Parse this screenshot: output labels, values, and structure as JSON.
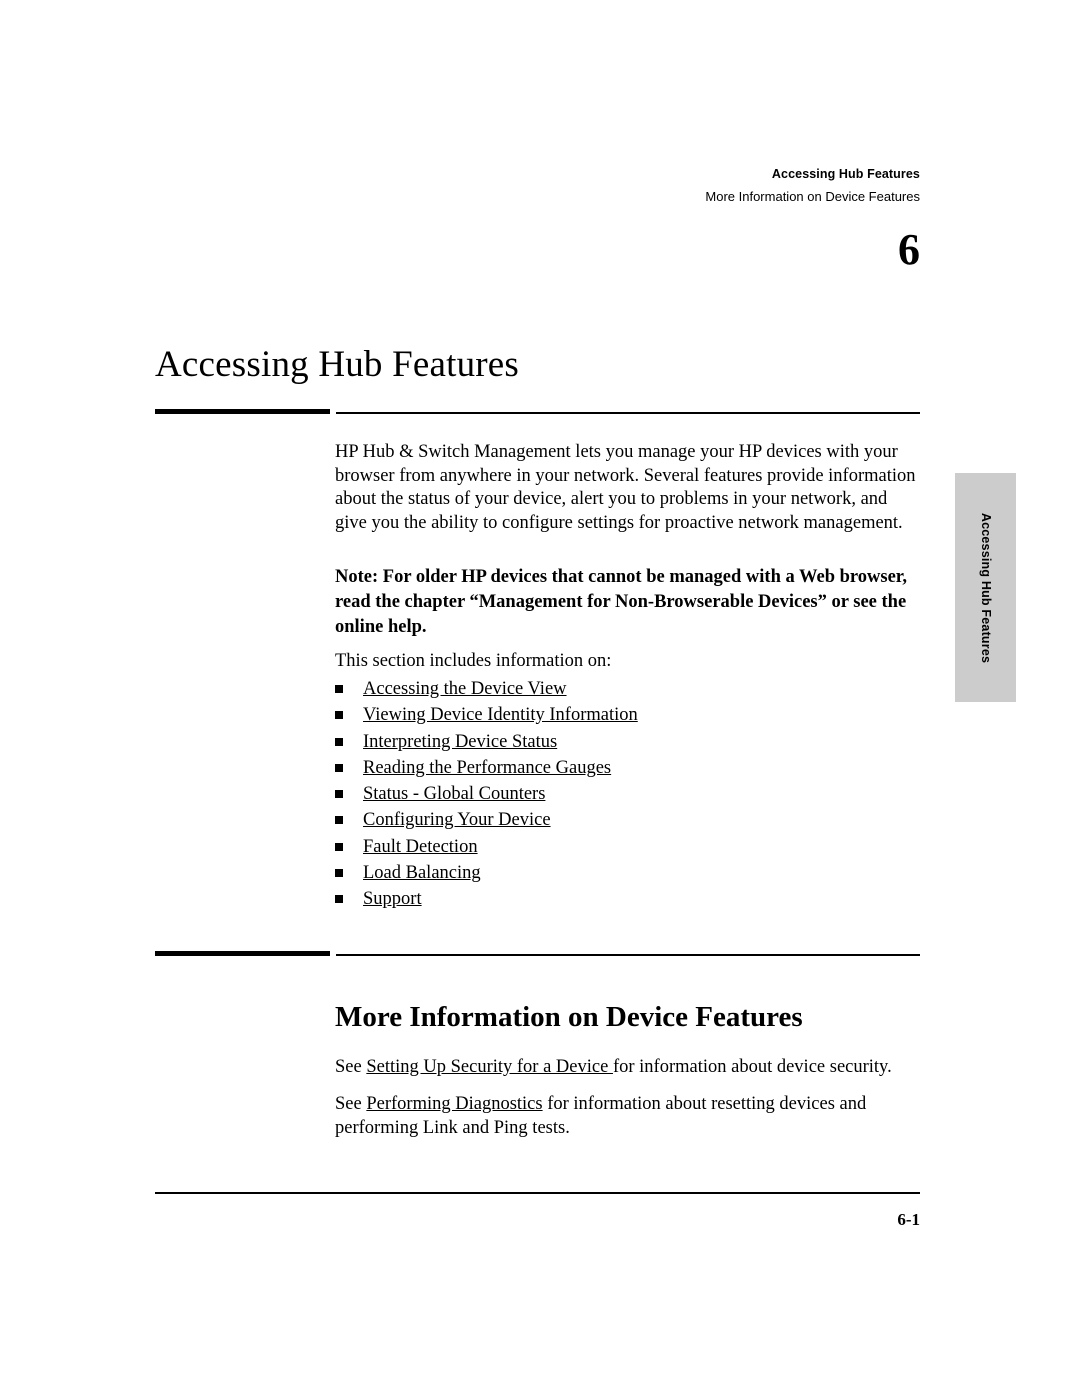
{
  "header": {
    "line1": "Accessing Hub Features",
    "line2": "More Information on Device Features"
  },
  "chapter": {
    "number": "6",
    "title": "Accessing Hub Features"
  },
  "intro": {
    "paragraph": "HP Hub & Switch Management lets you manage your HP devices with your browser from anywhere in your network. Several features provide information about the status of your device, alert you to problems in your network, and give you the ability to configure settings for proactive network management.",
    "note": "Note: For older HP devices that cannot be managed with a Web browser, read the chapter “Management for Non-Browserable Devices” or see the online help.",
    "lead_in": "This section includes information on:"
  },
  "links": [
    {
      "label": "Accessing the Device View"
    },
    {
      "label": "Viewing Device Identity Information"
    },
    {
      "label": "Interpreting Device Status"
    },
    {
      "label": "Reading the Performance Gauges"
    },
    {
      "label": "Status - Global Counters"
    },
    {
      "label": "Configuring Your Device"
    },
    {
      "label": "Fault Detection"
    },
    {
      "label": "Load Balancing"
    },
    {
      "label": "Support"
    }
  ],
  "section": {
    "heading": "More Information on Device Features",
    "para1_before": "See ",
    "para1_link": "Setting Up Security for a Device ",
    "para1_after": "for information about device security.",
    "para2_before": "See ",
    "para2_link": "Performing Diagnostics",
    "para2_after": " for information about resetting devices and performing Link and Ping tests."
  },
  "side_tab": {
    "label": "Accessing Hub Features"
  },
  "footer": {
    "page_number": "6-1"
  }
}
